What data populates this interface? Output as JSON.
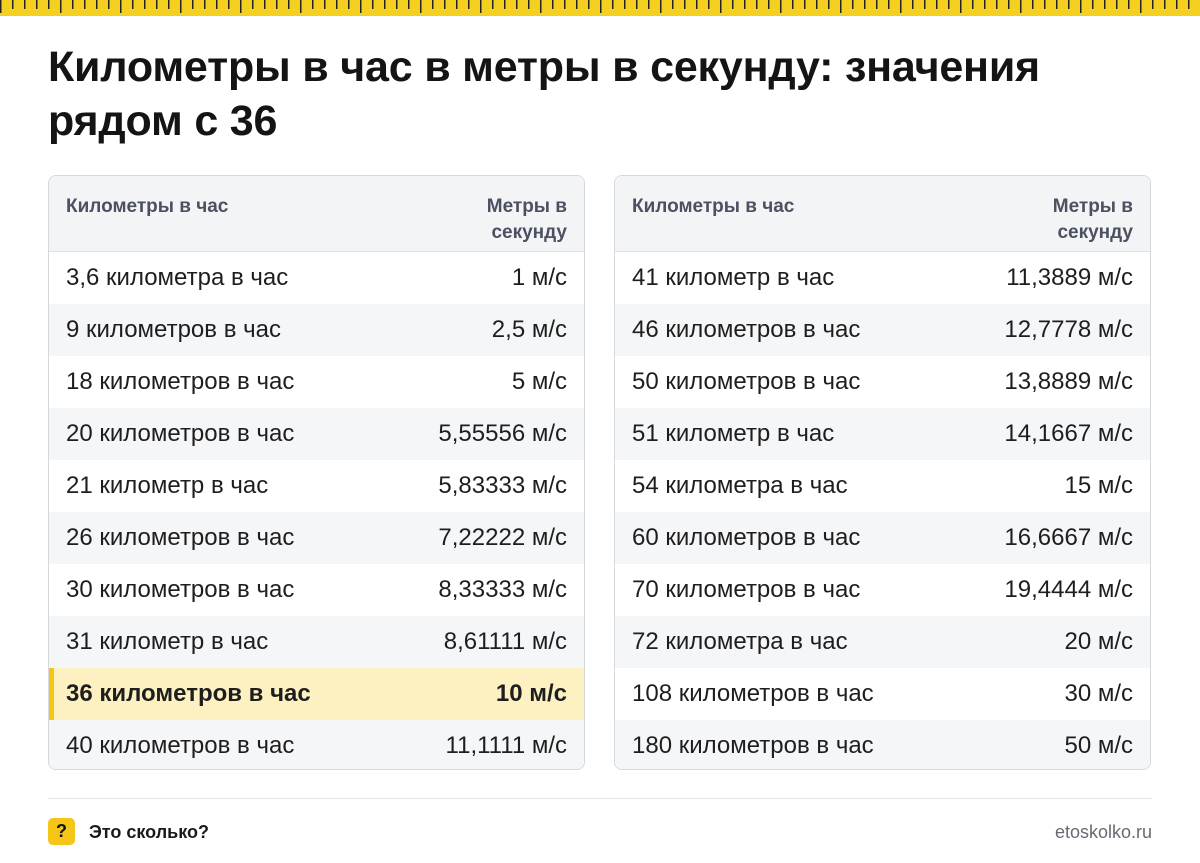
{
  "title": "Километры в час в метры в секунду: значения рядом с 36",
  "columns": {
    "left": "Километры в час",
    "right": "Метры в секунду"
  },
  "left_table": [
    {
      "kmh": "3,6 километра в час",
      "ms": "1 м/с"
    },
    {
      "kmh": "9 километров в час",
      "ms": "2,5 м/с"
    },
    {
      "kmh": "18 километров в час",
      "ms": "5 м/с"
    },
    {
      "kmh": "20 километров в час",
      "ms": "5,55556 м/с"
    },
    {
      "kmh": "21 километр в час",
      "ms": "5,83333 м/с"
    },
    {
      "kmh": "26 километров в час",
      "ms": "7,22222 м/с"
    },
    {
      "kmh": "30 километров в час",
      "ms": "8,33333 м/с"
    },
    {
      "kmh": "31 километр в час",
      "ms": "8,61111 м/с"
    },
    {
      "kmh": "36 километров в час",
      "ms": "10 м/с",
      "highlight": true
    },
    {
      "kmh": "40 километров в час",
      "ms": "11,1111 м/с"
    }
  ],
  "right_table": [
    {
      "kmh": "41 километр в час",
      "ms": "11,3889 м/с"
    },
    {
      "kmh": "46 километров в час",
      "ms": "12,7778 м/с"
    },
    {
      "kmh": "50 километров в час",
      "ms": "13,8889 м/с"
    },
    {
      "kmh": "51 километр в час",
      "ms": "14,1667 м/с"
    },
    {
      "kmh": "54 километра в час",
      "ms": "15 м/с"
    },
    {
      "kmh": "60 километров в час",
      "ms": "16,6667 м/с"
    },
    {
      "kmh": "70 километров в час",
      "ms": "19,4444 м/с"
    },
    {
      "kmh": "72 километра в час",
      "ms": "20 м/с"
    },
    {
      "kmh": "108 километров в час",
      "ms": "30 м/с"
    },
    {
      "kmh": "180 километров в час",
      "ms": "50 м/с"
    }
  ],
  "footer": {
    "badge": "?",
    "brand": "Это сколько?",
    "site": "etoskolko.ru"
  },
  "colors": {
    "accent": "#f5c518",
    "highlight_row": "#fdf1c2",
    "header_bg": "#f3f4f6"
  }
}
